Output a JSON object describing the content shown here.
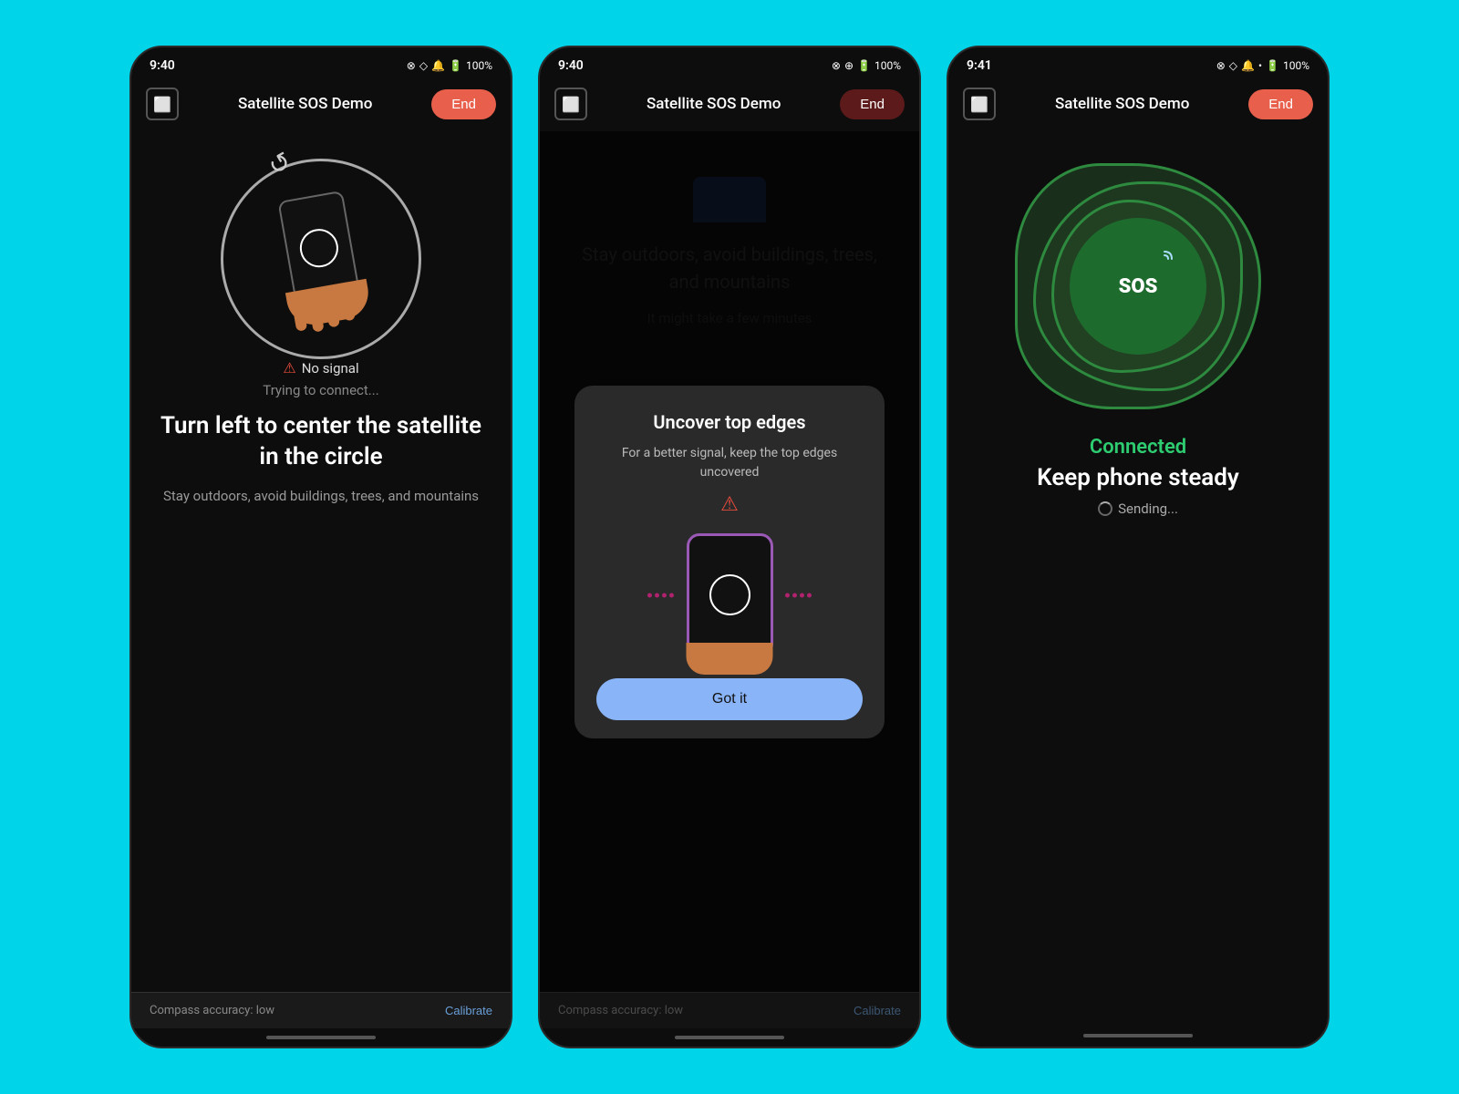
{
  "background_color": "#00d4e8",
  "phones": [
    {
      "id": "screen1",
      "status_bar": {
        "time": "9:40",
        "battery": "100%"
      },
      "header": {
        "title": "Satellite SOS Demo",
        "end_label": "End"
      },
      "signal_status": "No signal",
      "connecting_text": "Trying to connect...",
      "instruction_title": "Turn left to center the satellite in the circle",
      "instruction_sub": "Stay outdoors, avoid buildings, trees, and mountains",
      "bottom": {
        "compass_text": "Compass accuracy: low",
        "calibrate_label": "Calibrate"
      }
    },
    {
      "id": "screen2",
      "status_bar": {
        "time": "9:40",
        "battery": "100%"
      },
      "header": {
        "title": "Satellite SOS Demo",
        "end_label": "End"
      },
      "bg_instruction": "Stay outdoors, avoid buildings, trees, and mountains",
      "bg_sub": "It might take a few minutes",
      "modal": {
        "title": "Uncover top edges",
        "description": "For a better signal, keep the top edges uncovered",
        "got_it_label": "Got it"
      },
      "bottom": {
        "compass_text": "Compass accuracy: low",
        "calibrate_label": "Calibrate"
      }
    },
    {
      "id": "screen3",
      "status_bar": {
        "time": "9:41",
        "battery": "100%"
      },
      "header": {
        "title": "Satellite SOS Demo",
        "end_label": "End"
      },
      "connected_label": "Connected",
      "steady_label": "Keep phone steady",
      "sending_label": "Sending..."
    }
  ]
}
